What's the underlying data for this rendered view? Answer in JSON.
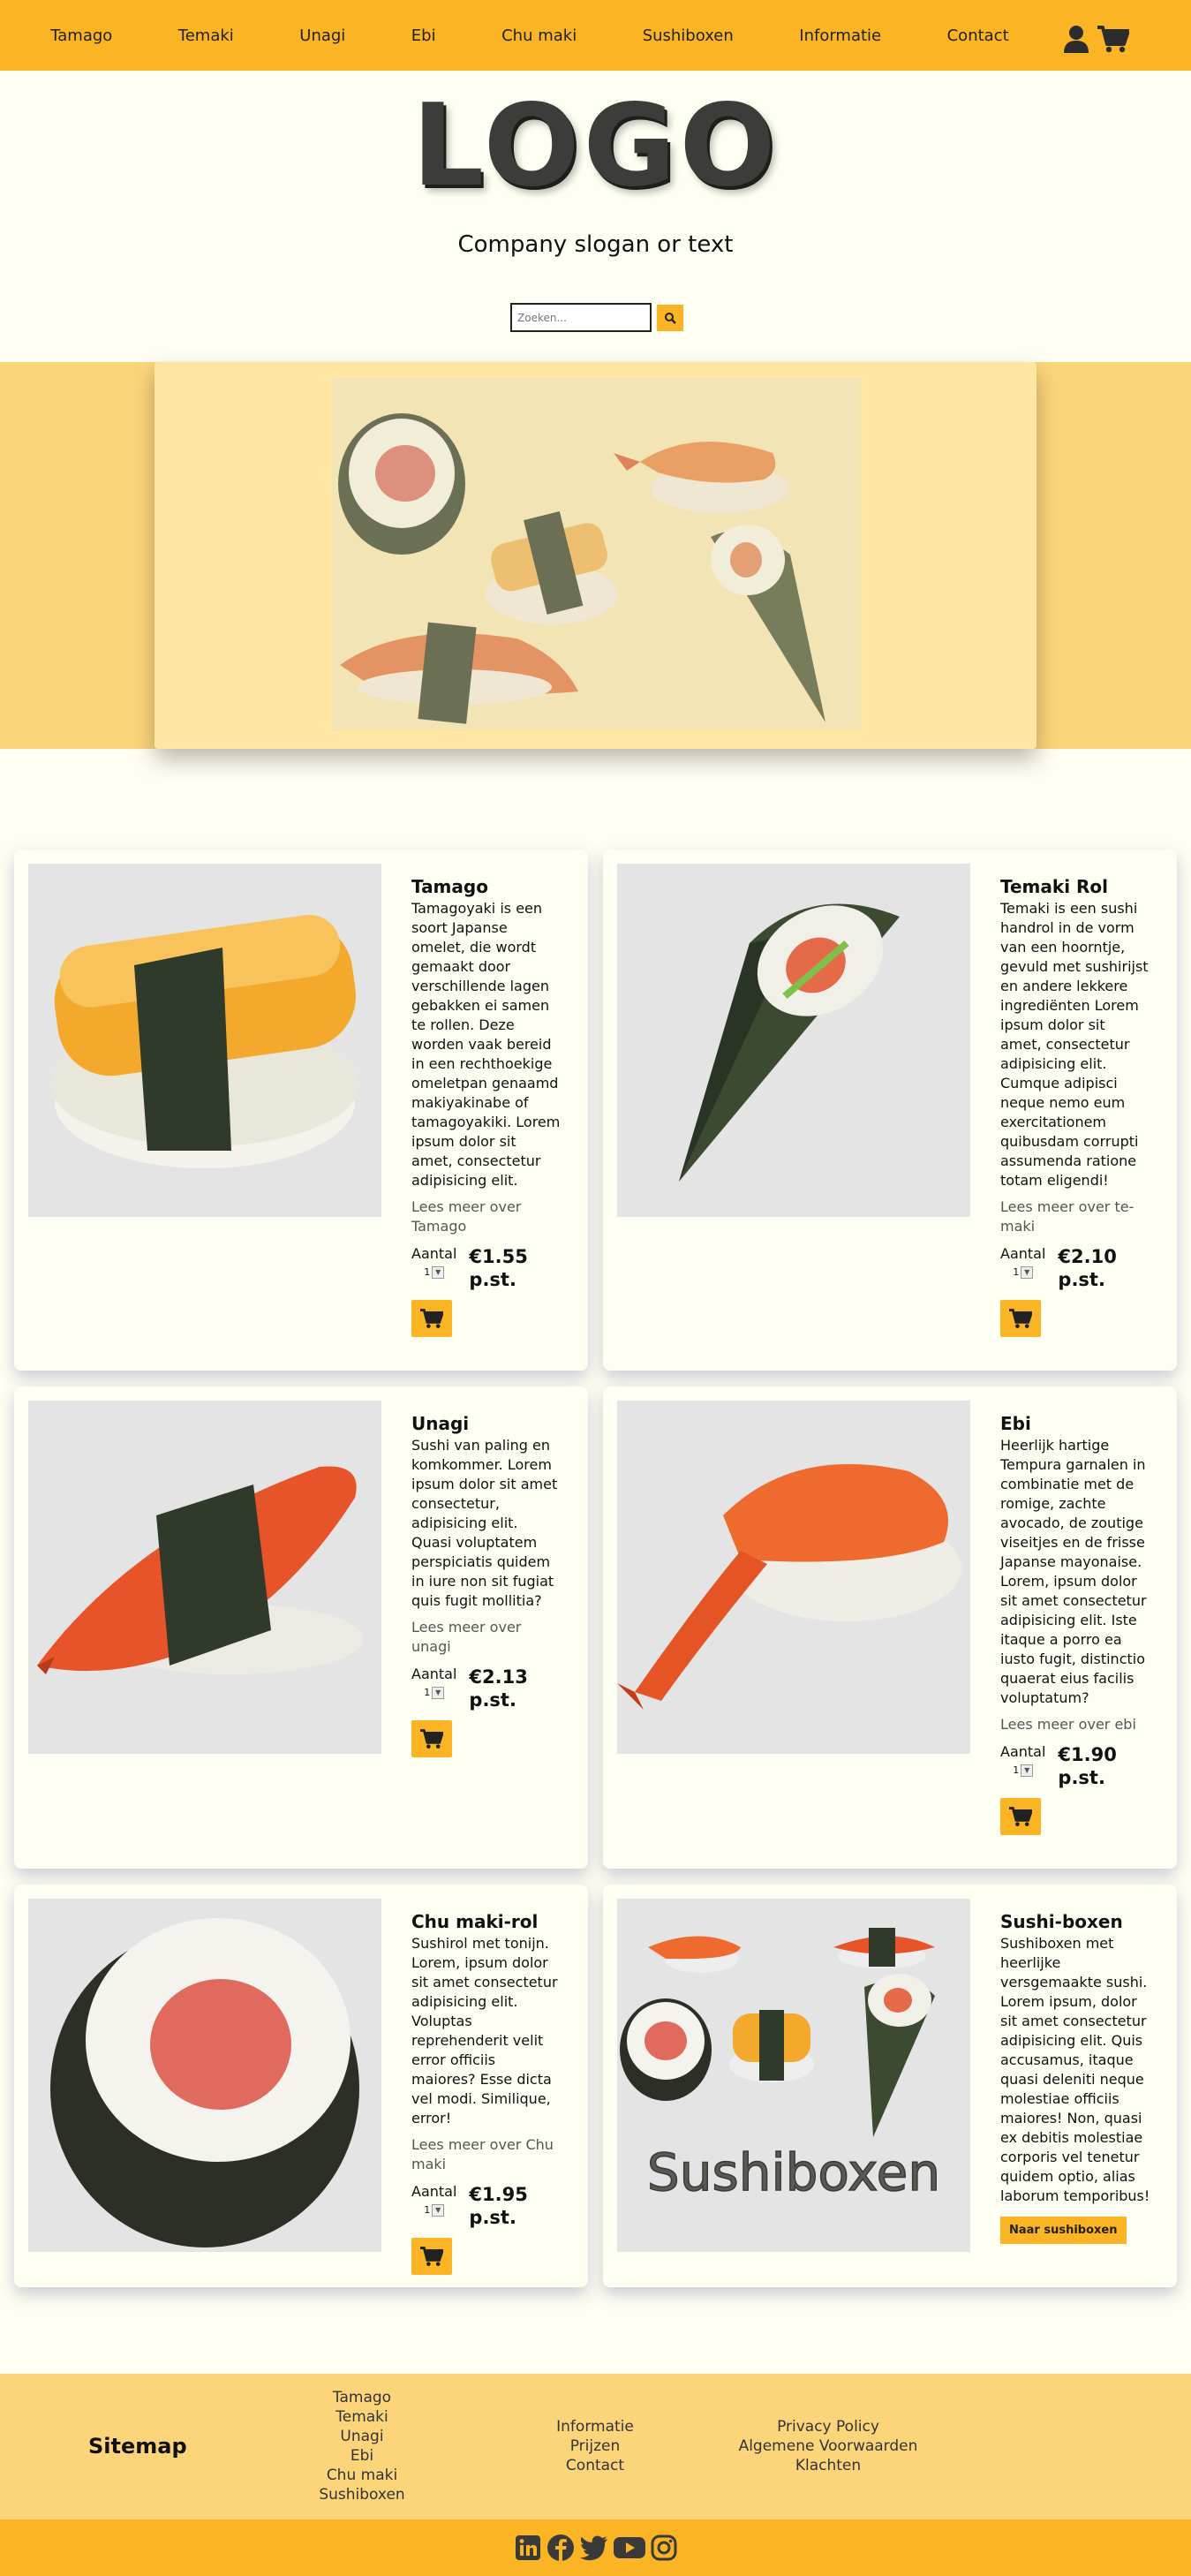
{
  "nav": {
    "links": [
      "Tamago",
      "Temaki",
      "Unagi",
      "Ebi",
      "Chu maki",
      "Sushiboxen",
      "Informatie",
      "Contact"
    ],
    "icons": [
      "user-icon",
      "cart-icon"
    ]
  },
  "header": {
    "logo": "LOGO",
    "slogan": "Company slogan or text",
    "search_placeholder": "Zoeken..."
  },
  "products": [
    {
      "name": "Tamago",
      "description": "Tamagoyaki is een soort Japanse omelet, die wordt gemaakt door verschillende lagen gebakken ei samen te rollen. Deze worden vaak bereid in een rechthoekige omeletpan genaamd makiyakinabe of tamagoyakiki. Lorem ipsum dolor sit amet, consectetur adipisicing elit.",
      "more": "Lees meer over Tamago",
      "qty_label": "Aantal",
      "qty_value": "1",
      "price": "€1.55 p.st."
    },
    {
      "name": "Temaki Rol",
      "description": "Temaki is een sushi handrol in de vorm van een hoorntje, gevuld met sushirijst en andere lekkere ingrediënten Lorem ipsum dolor sit amet, consectetur adipisicing elit. Cumque adipisci neque nemo eum exercitationem quibusdam corrupti assumenda ratione totam eligendi!",
      "more": "Lees meer over te-maki",
      "qty_label": "Aantal",
      "qty_value": "1",
      "price": "€2.10 p.st."
    },
    {
      "name": "Unagi",
      "description": "Sushi van paling en komkommer. Lorem ipsum dolor sit amet consectetur, adipisicing elit. Quasi voluptatem perspiciatis quidem in iure non sit fugiat quis fugit mollitia?",
      "more": "Lees meer over unagi",
      "qty_label": "Aantal",
      "qty_value": "1",
      "price": "€2.13 p.st."
    },
    {
      "name": "Ebi",
      "description": "Heerlijk hartige Tempura garnalen in combinatie met de romige, zachte avocado, de zoutige viseitjes en de frisse Japanse mayonaise. Lorem, ipsum dolor sit amet consectetur adipisicing elit. Iste itaque a porro ea iusto fugit, distinctio quaerat eius facilis voluptatum?",
      "more": "Lees meer over ebi",
      "qty_label": "Aantal",
      "qty_value": "1",
      "price": "€1.90 p.st."
    },
    {
      "name": "Chu maki-rol",
      "description": "Sushirol met tonijn. Lorem, ipsum dolor sit amet consectetur adipisicing elit. Voluptas reprehenderit velit error officiis maiores? Esse dicta vel modi. Similique, error!",
      "more": "Lees meer over Chu maki",
      "qty_label": "Aantal",
      "qty_value": "1",
      "price": "€1.95 p.st."
    },
    {
      "name": "Sushi-boxen",
      "description": "Sushiboxen met heerlijke versgemaakte sushi. Lorem ipsum, dolor sit amet consectetur adipisicing elit. Quis accusamus, itaque quasi deleniti neque molestiae officiis maiores! Non, quasi ex debitis molestiae corporis vel tenetur quidem optio, alias laborum temporibus!",
      "button": "Naar sushiboxen",
      "image_text": "Sushiboxen"
    }
  ],
  "footer": {
    "sitemap_title": "Sitemap",
    "col1": [
      "Tamago",
      "Temaki",
      "Unagi",
      "Ebi",
      "Chu maki",
      "Sushiboxen"
    ],
    "col2": [
      "Informatie",
      "Prijzen",
      "Contact"
    ],
    "col3": [
      "Privacy Policy",
      "Algemene Voorwaarden",
      "Klachten"
    ],
    "social_icons": [
      "linkedin-icon",
      "facebook-icon",
      "twitter-icon",
      "youtube-icon",
      "instagram-icon"
    ]
  },
  "colors": {
    "accent": "#fbb424",
    "band": "#fcd57b",
    "background": "#fffef2"
  }
}
